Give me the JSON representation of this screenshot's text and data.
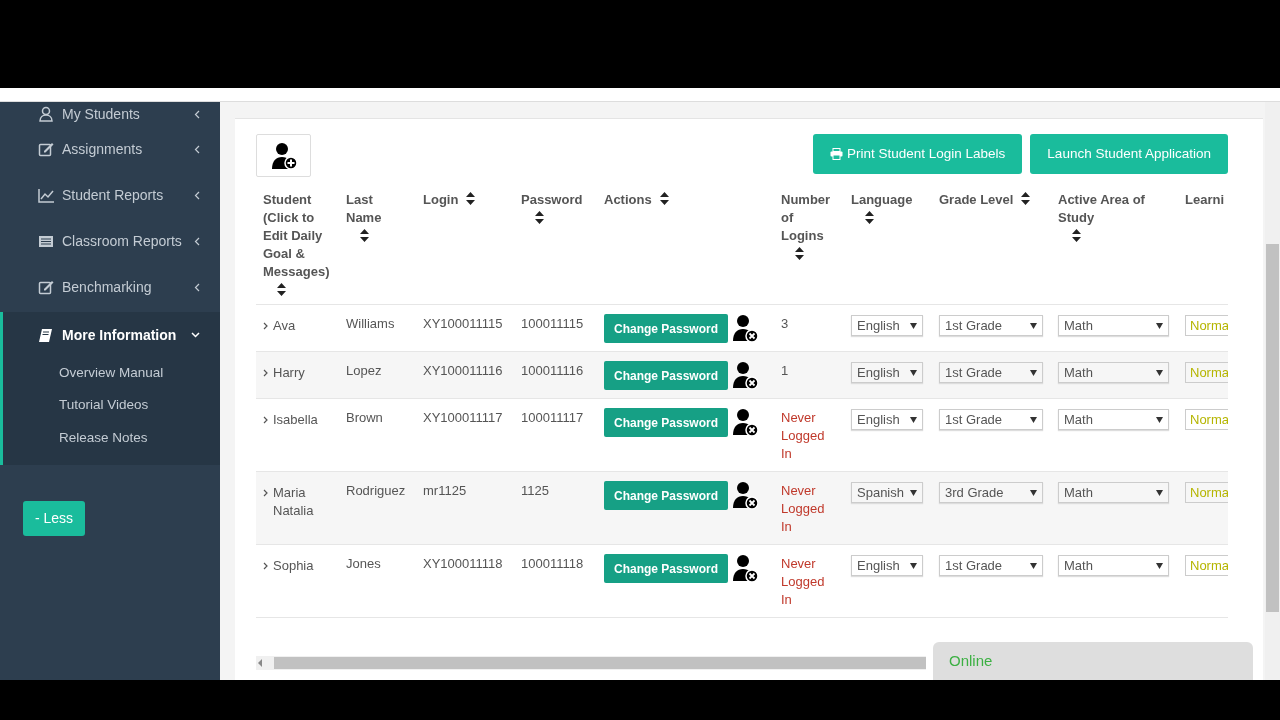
{
  "sidebar": {
    "items": [
      {
        "label": "My Students",
        "expanded": false,
        "selected": false
      },
      {
        "label": "Assignments",
        "expanded": false,
        "selected": false
      },
      {
        "label": "Student Reports",
        "expanded": false,
        "selected": false
      },
      {
        "label": "Classroom Reports",
        "expanded": false,
        "selected": false
      },
      {
        "label": "Benchmarking",
        "expanded": false,
        "selected": false
      },
      {
        "label": "More Information",
        "expanded": true,
        "selected": true,
        "children": [
          {
            "label": "Overview Manual"
          },
          {
            "label": "Tutorial Videos"
          },
          {
            "label": "Release Notes"
          }
        ]
      }
    ],
    "less_button": "- Less"
  },
  "toolbar": {
    "buttons": [
      {
        "label": "Print Student Login Labels"
      },
      {
        "label": "Launch Student Application"
      }
    ]
  },
  "table": {
    "columns": [
      {
        "label": "Student (Click to Edit Daily Goal & Messages)"
      },
      {
        "label": "Last Name"
      },
      {
        "label": "Login"
      },
      {
        "label": "Password"
      },
      {
        "label": "Actions"
      },
      {
        "label": "Number of Logins"
      },
      {
        "label": "Language"
      },
      {
        "label": "Grade Level"
      },
      {
        "label": "Active Area of Study"
      },
      {
        "label": "Learni"
      }
    ],
    "rows": [
      {
        "student": "Ava",
        "last_name": "Williams",
        "login": "XY100011115",
        "password": "100011115",
        "action": "Change Password",
        "logins": "3",
        "logged_in": true,
        "language": "English",
        "grade": "1st Grade",
        "area": "Math",
        "learning": "Norma"
      },
      {
        "student": "Harry",
        "last_name": "Lopez",
        "login": "XY100011116",
        "password": "100011116",
        "action": "Change Password",
        "logins": "1",
        "logged_in": true,
        "language": "English",
        "grade": "1st Grade",
        "area": "Math",
        "learning": "Norma"
      },
      {
        "student": "Isabella",
        "last_name": "Brown",
        "login": "XY100011117",
        "password": "100011117",
        "action": "Change Password",
        "logins": "Never Logged In",
        "logged_in": false,
        "language": "English",
        "grade": "1st Grade",
        "area": "Math",
        "learning": "Norma"
      },
      {
        "student": "Maria Natalia",
        "last_name": "Rodriguez",
        "login": "mr1125",
        "password": "1125",
        "action": "Change Password",
        "logins": "Never Logged In",
        "logged_in": false,
        "language": "Spanish",
        "grade": "3rd Grade",
        "area": "Math",
        "learning": "Norma"
      },
      {
        "student": "Sophia",
        "last_name": "Jones",
        "login": "XY100011118",
        "password": "100011118",
        "action": "Change Password",
        "logins": "Never Logged In",
        "logged_in": false,
        "language": "English",
        "grade": "1st Grade",
        "area": "Math",
        "learning": "Norma"
      }
    ]
  },
  "chat_widget": {
    "status": "Online"
  }
}
